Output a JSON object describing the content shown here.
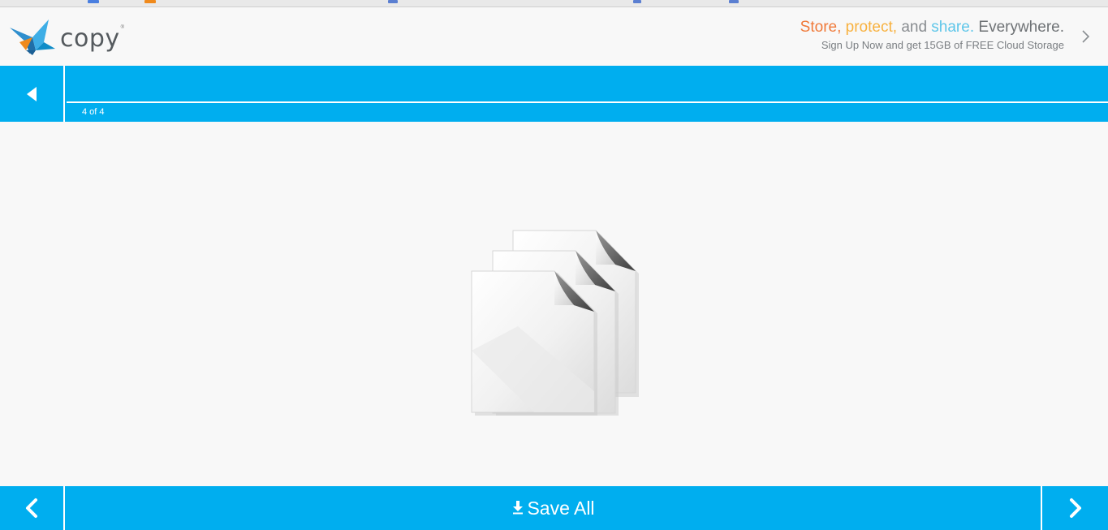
{
  "app": {
    "logo_text": "copy",
    "logo_tm": "®"
  },
  "promo": {
    "word_store": "Store,",
    "word_protect": "protect,",
    "word_and": "and",
    "word_share": "share.",
    "word_everywhere": "Everywhere.",
    "tagline": "Sign Up Now and get 15GB of FREE Cloud Storage"
  },
  "viewer": {
    "title": "",
    "page_counter": "4 of 4"
  },
  "footer": {
    "save_all_label": "Save All"
  },
  "colors": {
    "accent": "#00aeef",
    "promo_orange": "#f07a3a",
    "promo_yellow": "#f8b13e",
    "promo_blue": "#5ec6e9"
  },
  "icons": {
    "back": "triangle-left-icon",
    "prev": "chevron-left-icon",
    "next": "chevron-right-icon",
    "download": "download-icon",
    "files": "multiple-files-icon",
    "promo_chevron": "chevron-right-icon"
  }
}
